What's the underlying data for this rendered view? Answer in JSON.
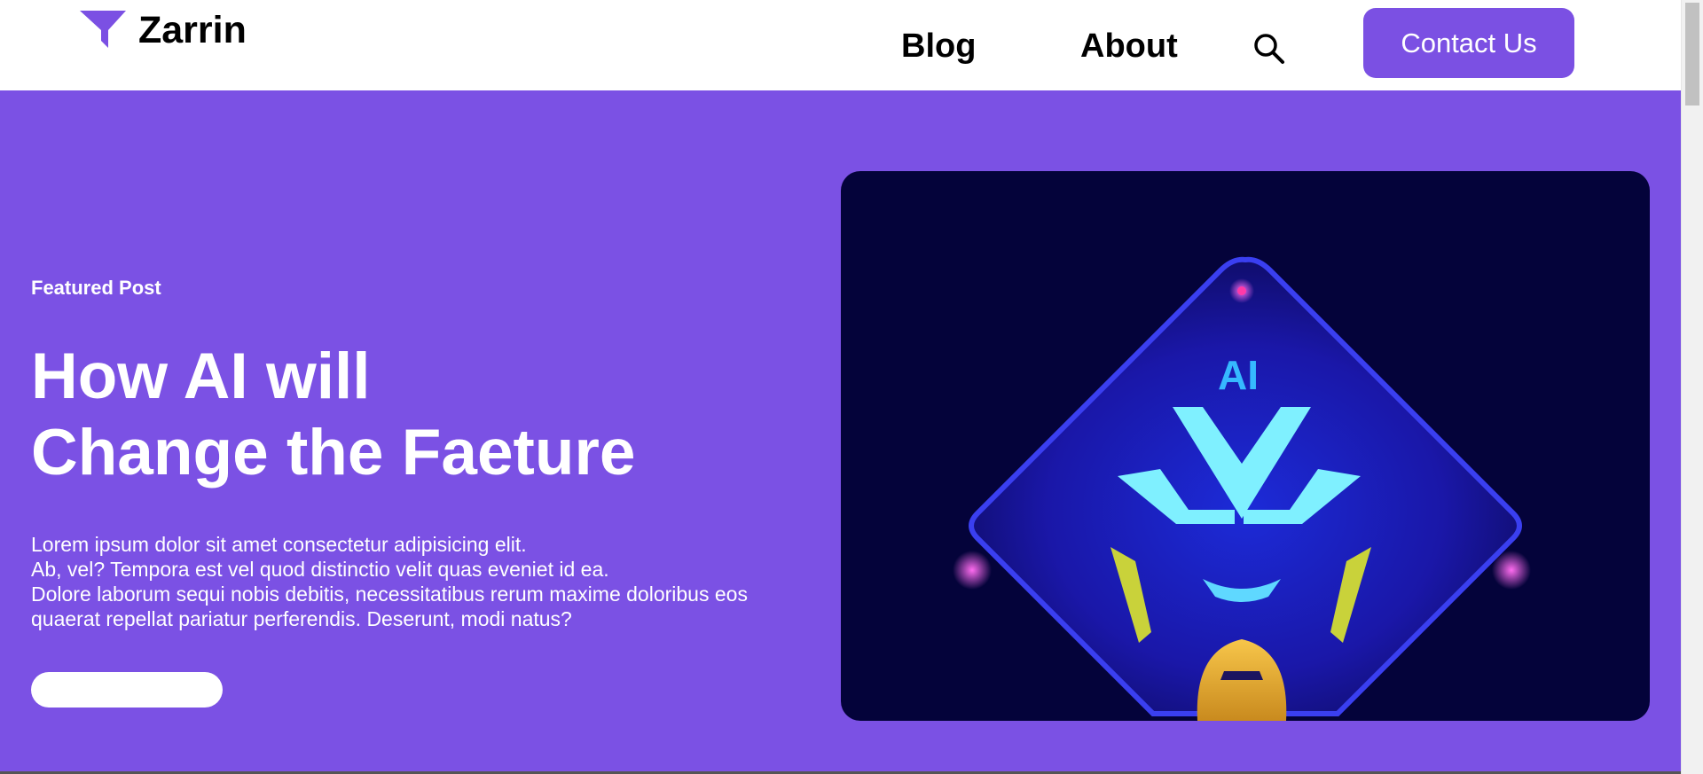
{
  "brand": {
    "name": "Zarrin",
    "icon": "funnel-icon",
    "accent_color": "#7b50e3"
  },
  "nav": {
    "blog_label": "Blog",
    "about_label": "About",
    "search_icon": "search-icon",
    "contact_label": "Contact Us"
  },
  "hero": {
    "background_color": "#7b51e4",
    "eyebrow": "Featured Post",
    "title_lines": [
      "How AI will",
      "Change the Faeture"
    ],
    "description_lines": [
      "Lorem ipsum dolor sit amet consectetur adipisicing elit.",
      "Ab, vel? Tempora est vel quod distinctio velit quas eveniet id ea.",
      "Dolore laborum sequi nobis debitis, necessitatibus rerum maxime doloribus eos",
      "quaerat repellat pariatur perferendis. Deserunt, modi natus?"
    ],
    "image": {
      "icon": "ai-robot-illustration",
      "badge_text": "AI",
      "background_color": "#04033a"
    }
  }
}
